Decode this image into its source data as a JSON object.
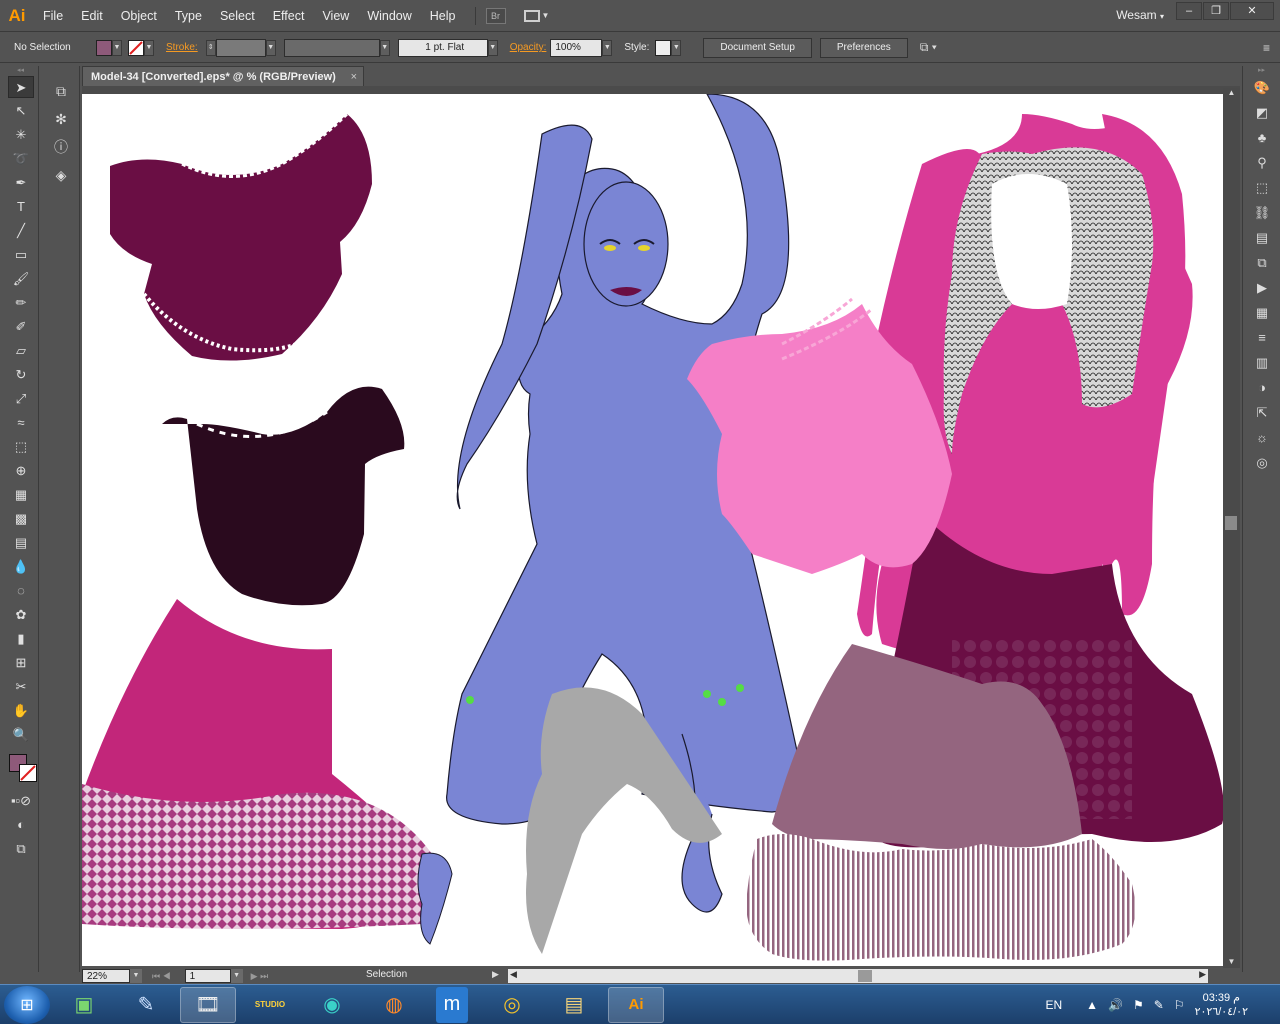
{
  "app": {
    "logo": "Ai",
    "menu": [
      "File",
      "Edit",
      "Object",
      "Type",
      "Select",
      "Effect",
      "View",
      "Window",
      "Help"
    ],
    "bridge_label": "Br",
    "user": "Wesam",
    "window_controls": [
      "–",
      "❐",
      "✕"
    ]
  },
  "control_bar": {
    "selection_label": "No Selection",
    "fill_color": "#8e5a7a",
    "stroke_label": "Stroke:",
    "stroke_profile": "1 pt. Flat",
    "opacity_label": "Opacity:",
    "opacity_value": "100%",
    "style_label": "Style:",
    "document_setup": "Document Setup",
    "preferences": "Preferences"
  },
  "document": {
    "tab_title": "Model-34 [Converted].eps* @ % (RGB/Preview)",
    "close_glyph": "×"
  },
  "status": {
    "zoom": "22%",
    "page": "1",
    "tool": "Selection"
  },
  "taskbar": {
    "apps": [
      {
        "name": "windows-start",
        "glyph": "⊞"
      },
      {
        "name": "system-monitor",
        "glyph": "▣"
      },
      {
        "name": "pen-app",
        "glyph": "✎"
      },
      {
        "name": "movie-maker",
        "glyph": "🎞"
      },
      {
        "name": "studio",
        "glyph": "STUDIO"
      },
      {
        "name": "edge",
        "glyph": "◉"
      },
      {
        "name": "firefox",
        "glyph": "◍"
      },
      {
        "name": "maxthon",
        "glyph": "m"
      },
      {
        "name": "chrome",
        "glyph": "◎"
      },
      {
        "name": "explorer",
        "glyph": "▤"
      },
      {
        "name": "illustrator",
        "glyph": "Ai"
      }
    ],
    "lang": "EN",
    "time": "م 03:39",
    "date": "٢٠٢٦/٠٤/٠٢"
  },
  "colors": {
    "ui_bg": "#535353",
    "accent_orange": "#f59a23",
    "model_blue": "#7a85d4",
    "hot_pink": "#d93a96",
    "magenta": "#c2267a",
    "dark_maroon": "#6a0e44",
    "plum": "#2a0a1e",
    "mauve": "#94657f",
    "light_pink": "#f57fc7",
    "hair_gray": "#a8a8a8"
  }
}
